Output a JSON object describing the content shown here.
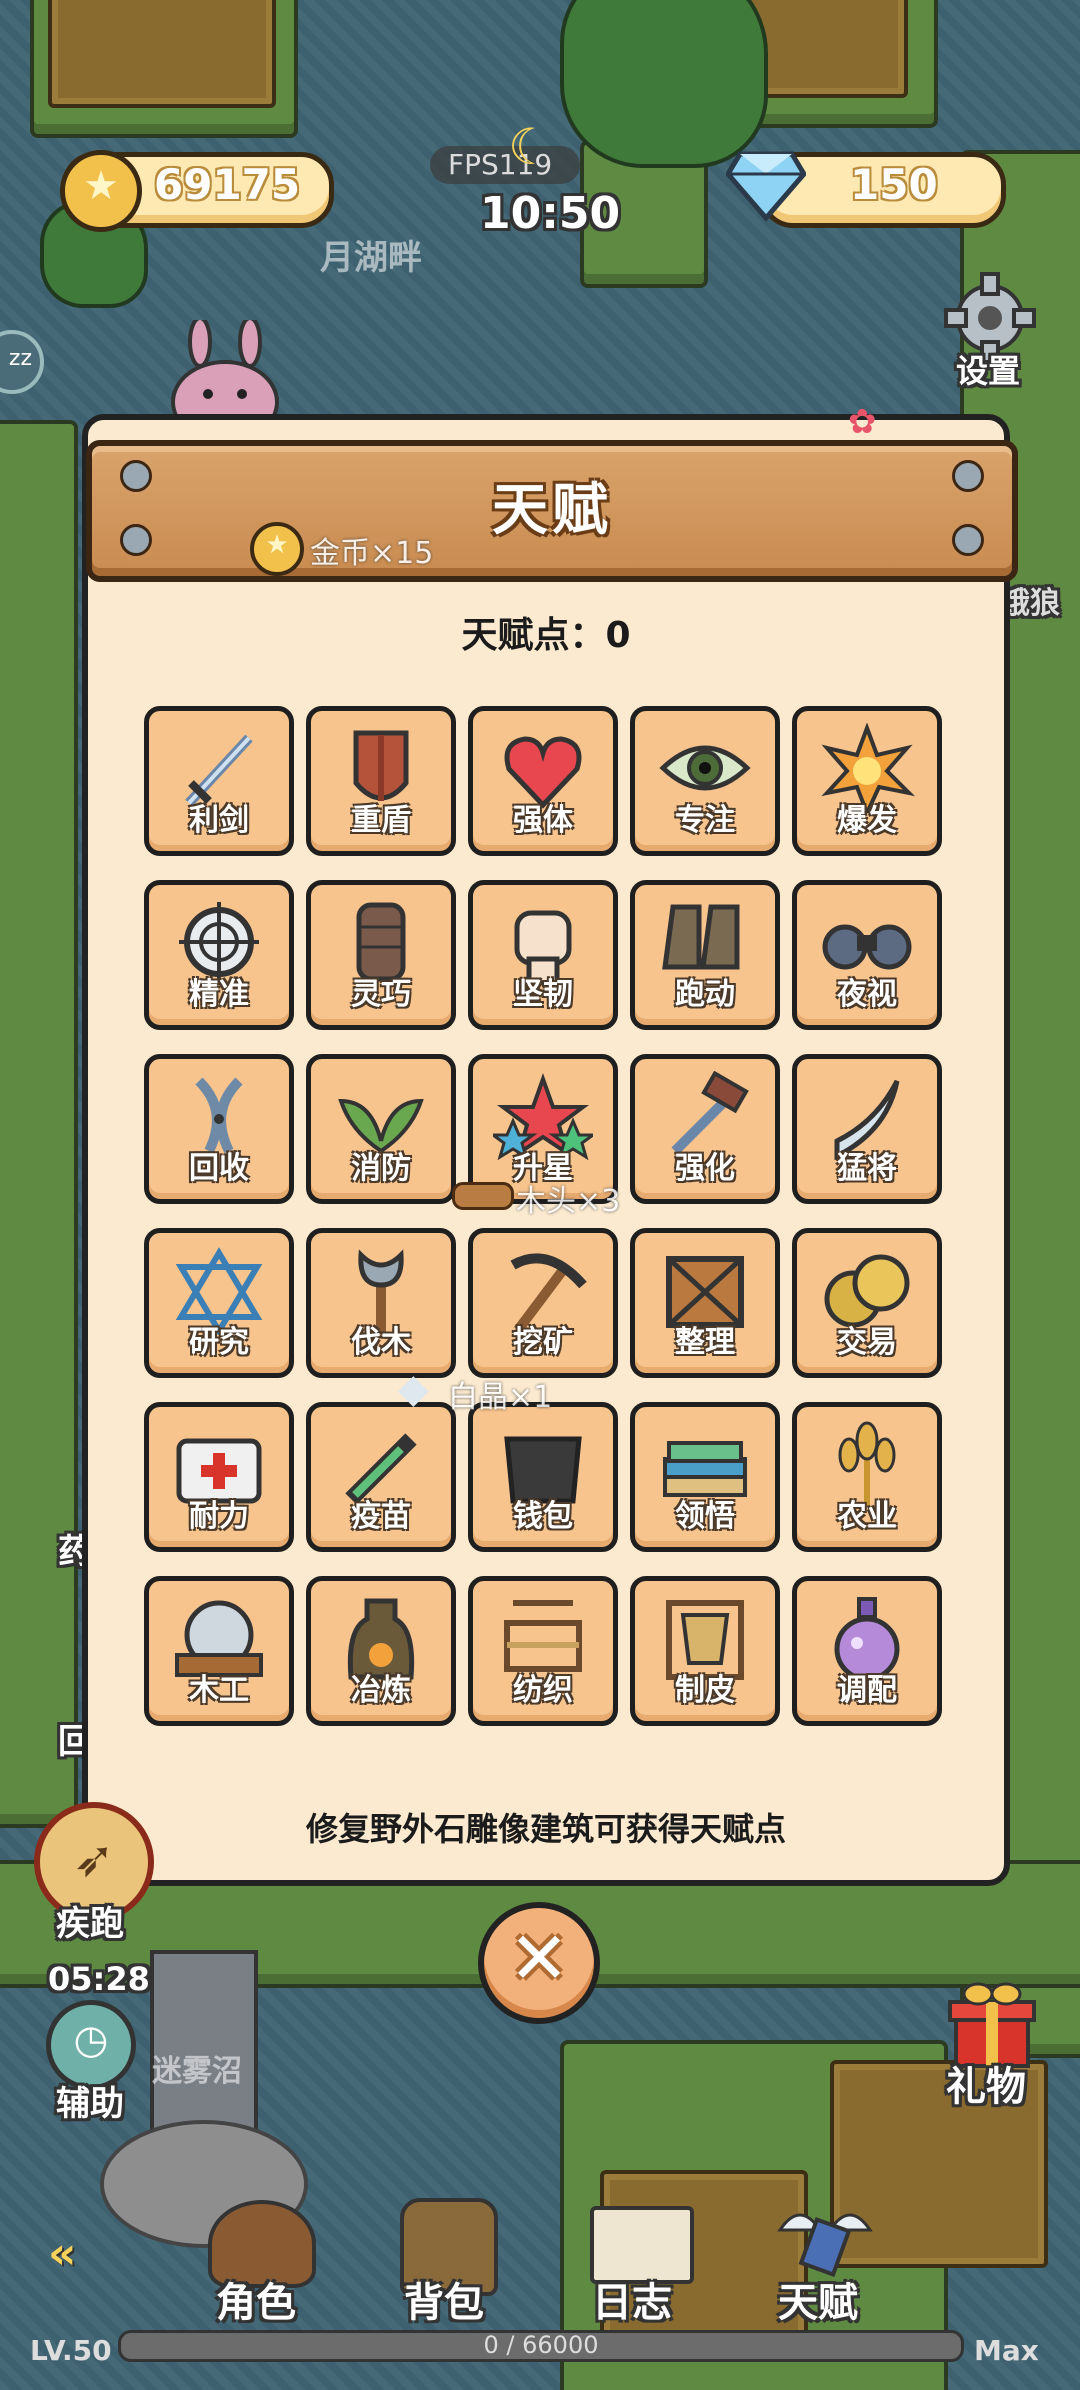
{
  "hud": {
    "coins": "69175",
    "gems": "150",
    "fps": "FPS119",
    "time": "10:50",
    "settings_label": "设置",
    "zzz": "zz"
  },
  "map_labels": {
    "lake": "月湖畔",
    "wolf": "饿狼",
    "fog": "迷雾沼",
    "gift": "礼物",
    "left_partial_1": "药",
    "left_partial_2": "回"
  },
  "skills_side": {
    "sprint_label": "疾跑",
    "sprint_timer": "05:28",
    "assist_label": "辅助"
  },
  "floating_rewards": {
    "coin": "金币×15",
    "wood": "木头×3",
    "crystal": "白晶×1"
  },
  "panel": {
    "title": "天赋",
    "points_text": "天赋点：0",
    "hint": "修复野外石雕像建筑可获得天赋点",
    "talents": [
      {
        "label": "利剑",
        "icon": "sword-icon"
      },
      {
        "label": "重盾",
        "icon": "shield-icon"
      },
      {
        "label": "强体",
        "icon": "heart-icon"
      },
      {
        "label": "专注",
        "icon": "eye-icon"
      },
      {
        "label": "爆发",
        "icon": "explosion-icon"
      },
      {
        "label": "精准",
        "icon": "crosshair-icon"
      },
      {
        "label": "灵巧",
        "icon": "glove-icon"
      },
      {
        "label": "坚韧",
        "icon": "fist-icon"
      },
      {
        "label": "跑动",
        "icon": "boots-icon"
      },
      {
        "label": "夜视",
        "icon": "binoculars-icon"
      },
      {
        "label": "回收",
        "icon": "scissors-icon"
      },
      {
        "label": "消防",
        "icon": "leaves-icon"
      },
      {
        "label": "升星",
        "icon": "stars-icon"
      },
      {
        "label": "强化",
        "icon": "hammer-sword-icon"
      },
      {
        "label": "猛将",
        "icon": "scythe-icon"
      },
      {
        "label": "研究",
        "icon": "hexagram-icon"
      },
      {
        "label": "伐木",
        "icon": "axe-icon"
      },
      {
        "label": "挖矿",
        "icon": "pickaxe-icon"
      },
      {
        "label": "整理",
        "icon": "crate-icon"
      },
      {
        "label": "交易",
        "icon": "coins-icon"
      },
      {
        "label": "耐力",
        "icon": "medkit-icon"
      },
      {
        "label": "疫苗",
        "icon": "syringe-icon"
      },
      {
        "label": "钱包",
        "icon": "wallet-icon"
      },
      {
        "label": "领悟",
        "icon": "books-icon"
      },
      {
        "label": "农业",
        "icon": "wheat-icon"
      },
      {
        "label": "木工",
        "icon": "saw-icon"
      },
      {
        "label": "冶炼",
        "icon": "furnace-icon"
      },
      {
        "label": "纺织",
        "icon": "loom-icon"
      },
      {
        "label": "制皮",
        "icon": "leather-rack-icon"
      },
      {
        "label": "调配",
        "icon": "potion-icon"
      }
    ]
  },
  "bottom_nav": {
    "character": "角色",
    "bag": "背包",
    "log": "日志",
    "talent": "天赋"
  },
  "xp": {
    "level": "LV.50",
    "progress": "0 / 66000",
    "max": "Max",
    "fraction": 0
  },
  "colors": {
    "panel_bg": "#fbead0",
    "tile_bg": "#f8c48e",
    "header_wood": "#d9a36b"
  }
}
